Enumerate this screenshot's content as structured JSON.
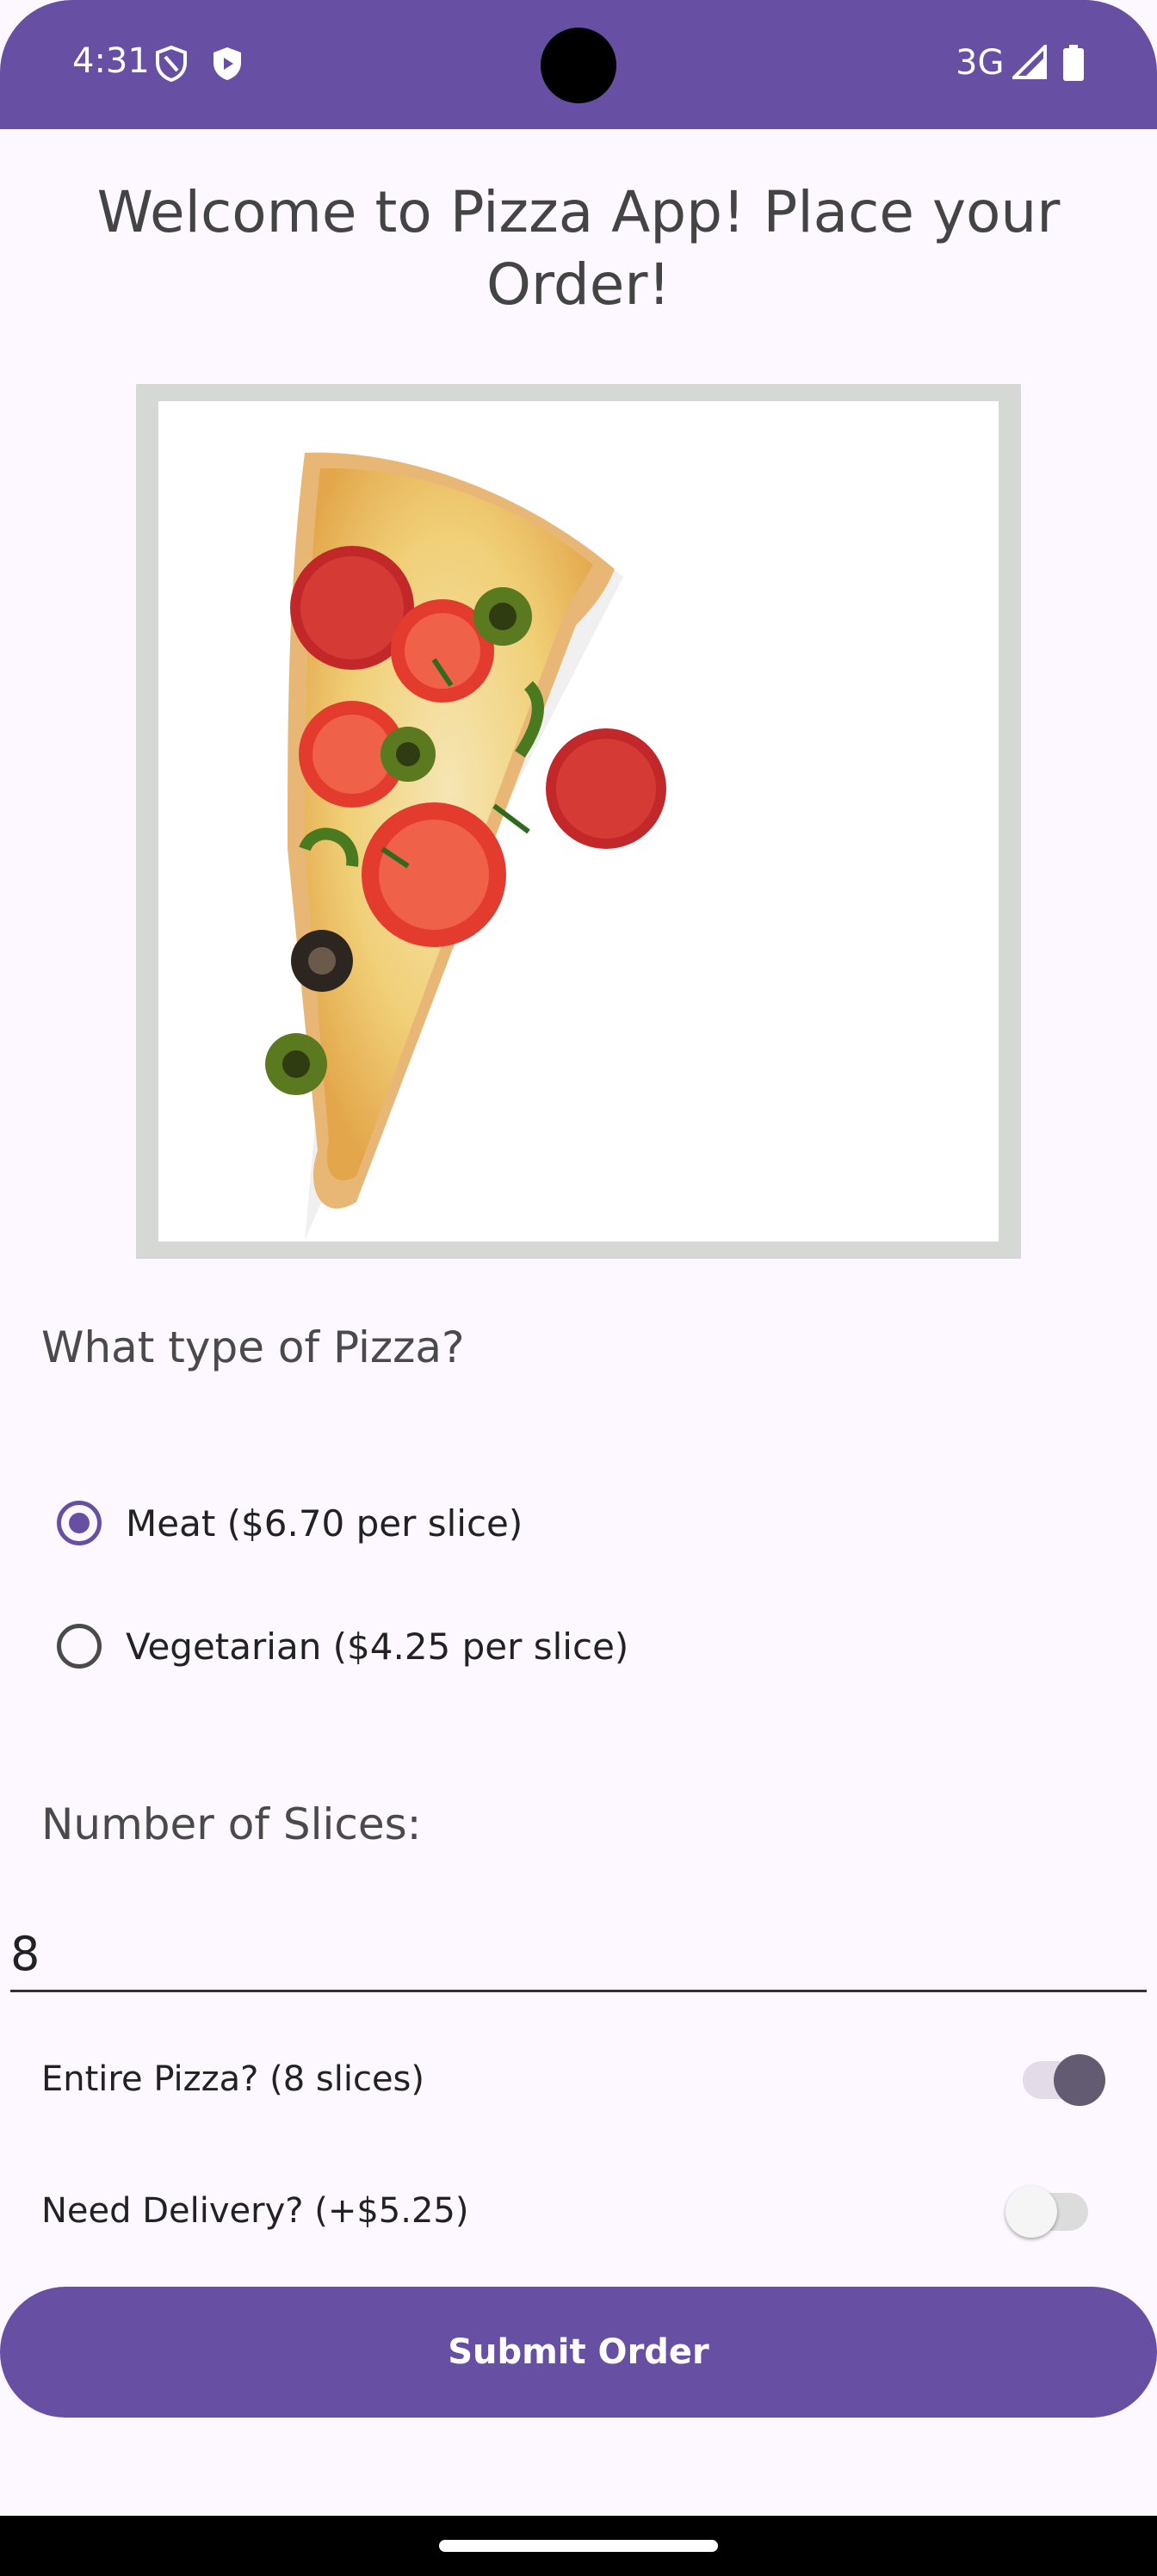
{
  "status_bar": {
    "time": "4:31",
    "network": "3G",
    "icons": [
      "vpn-shield-icon",
      "play-protect-icon",
      "signal-icon",
      "battery-icon"
    ]
  },
  "title": "Welcome to Pizza App! Place your Order!",
  "hero_image": {
    "icon": "pizza-slice-image"
  },
  "pizza_type": {
    "label": "What type of Pizza?",
    "options": [
      {
        "label": "Meat ($6.70 per slice)",
        "selected": true
      },
      {
        "label": "Vegetarian ($4.25 per slice)",
        "selected": false
      }
    ]
  },
  "slices": {
    "label": "Number of Slices:",
    "value": "8"
  },
  "entire_pizza": {
    "label": "Entire Pizza? (8 slices)",
    "on": true
  },
  "delivery": {
    "label": "Need Delivery? (+$5.25)",
    "on": false
  },
  "submit_label": "Submit Order",
  "colors": {
    "primary": "#674fa3",
    "background": "#fdf7ff",
    "switch_on_thumb": "#625b71",
    "switch_on_track": "#e7e0ec"
  }
}
